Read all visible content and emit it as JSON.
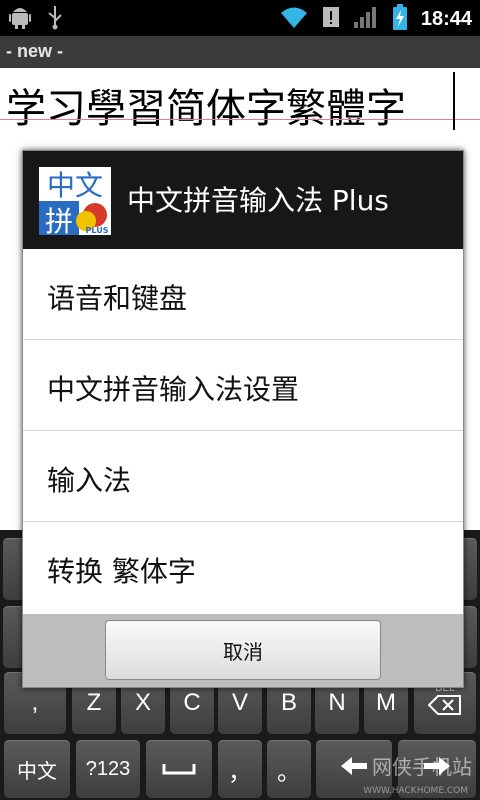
{
  "status_bar": {
    "time": "18:44",
    "icons": [
      "android-icon",
      "usb-icon",
      "wifi-icon",
      "alert-icon",
      "signal-icon",
      "battery-charging-icon"
    ]
  },
  "app": {
    "title": "- new -"
  },
  "editor": {
    "text": "学习學習简体字繁體字"
  },
  "dialog": {
    "logo": {
      "text_top": "中文",
      "text_bottom": "拼",
      "badge": "PLUS"
    },
    "title": "中文拼音输入法 Plus",
    "items": [
      {
        "label": "语音和键盘"
      },
      {
        "label": "中文拼音输入法设置"
      },
      {
        "label": "输入法"
      },
      {
        "label": "转换 繁体字"
      }
    ],
    "cancel_label": "取消"
  },
  "keyboard": {
    "row_letters": [
      ",",
      "Z",
      "X",
      "C",
      "V",
      "B",
      "N",
      "M"
    ],
    "bottom_row": {
      "lang": "中文",
      "symbols": "?123",
      "comma": "，",
      "period": "。"
    },
    "delete_label": "DEL",
    "watermark": "网侠手机站",
    "watermark_url": "WWW.HACKHOME.COM"
  },
  "colors": {
    "status_bar_bg": "#000000",
    "app_bar_bg": "#3b3b3b",
    "dialog_header_bg": "#171717",
    "logo_blue": "#2a6cc4",
    "logo_red": "#d63a2a",
    "logo_yellow": "#f2c200"
  }
}
